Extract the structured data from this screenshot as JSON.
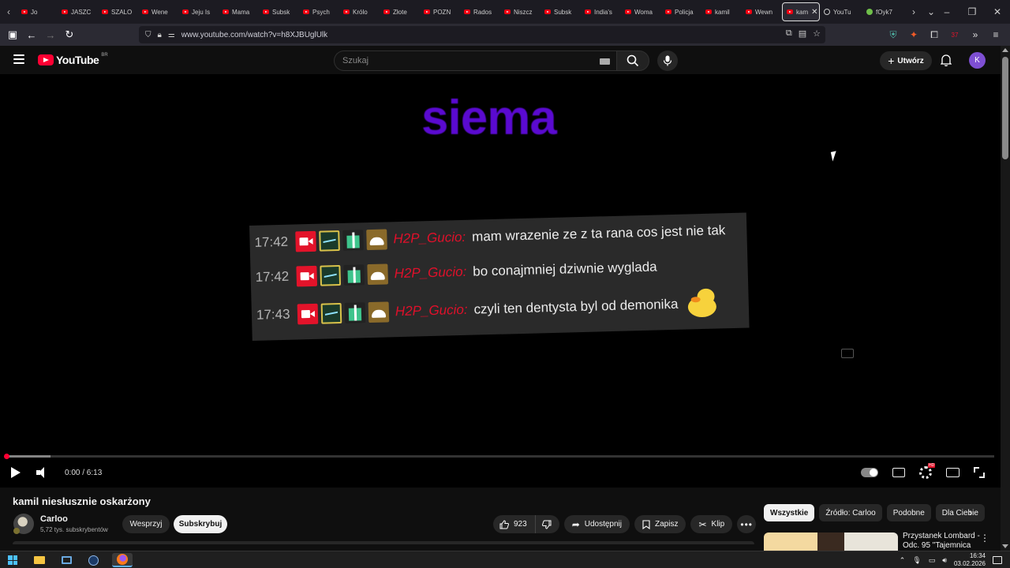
{
  "browser": {
    "tabs": [
      {
        "label": "Jo",
        "icon": "youtube-icon"
      },
      {
        "label": "JASZC",
        "icon": "youtube-icon"
      },
      {
        "label": "SZALO",
        "icon": "youtube-icon"
      },
      {
        "label": "Wene",
        "icon": "youtube-icon"
      },
      {
        "label": "Jeju Is",
        "icon": "youtube-icon"
      },
      {
        "label": "Mama",
        "icon": "youtube-icon"
      },
      {
        "label": "Subsk",
        "icon": "youtube-icon"
      },
      {
        "label": "Psych",
        "icon": "youtube-icon"
      },
      {
        "label": "Królo",
        "icon": "youtube-icon"
      },
      {
        "label": "Złote",
        "icon": "youtube-icon"
      },
      {
        "label": "POZN",
        "icon": "youtube-icon"
      },
      {
        "label": "Rados",
        "icon": "youtube-icon"
      },
      {
        "label": "Niszcz",
        "icon": "youtube-icon"
      },
      {
        "label": "Subsk",
        "icon": "youtube-icon"
      },
      {
        "label": "India's",
        "icon": "youtube-icon"
      },
      {
        "label": "Woma",
        "icon": "youtube-icon"
      },
      {
        "label": "Policja",
        "icon": "youtube-icon"
      },
      {
        "label": "kamil",
        "icon": "youtube-icon"
      },
      {
        "label": "Wewn",
        "icon": "youtube-icon"
      }
    ],
    "active_tab": {
      "label": "kam",
      "icon": "youtube-icon"
    },
    "after_tabs": [
      {
        "label": "YouTu"
      },
      {
        "label": "fOyk7"
      }
    ],
    "url": "www.youtube.com/watch?v=h8XJBUglUlk",
    "extension_badge": "37"
  },
  "youtube": {
    "logo_text": "YouTube",
    "region": "BR",
    "search_placeholder": "Szukaj",
    "create_label": "Utwórz",
    "avatar_letter": "K"
  },
  "video": {
    "overlay_text": "siema",
    "chat": [
      {
        "time": "17:42",
        "user": "H2P_Gucio:",
        "message": "mam wrazenie ze z ta rana cos jest nie tak"
      },
      {
        "time": "17:42",
        "user": "H2P_Gucio:",
        "message": "bo conajmniej dziwnie wyglada"
      },
      {
        "time": "17:43",
        "user": "H2P_Gucio:",
        "message": "czyli ten dentysta byl od demonika"
      }
    ],
    "time_display": "0:00 / 6:13",
    "progress_fraction": 0.0,
    "buffered_fraction": 0.045,
    "settings_badge": "HD"
  },
  "info": {
    "title": "kamil niesłusznie oskarżony",
    "channel_name": "Carloo",
    "subscribers": "5,72 tys. subskrybentów",
    "support_label": "Wesprzyj",
    "subscribe_label": "Subskrybuj",
    "likes": "923",
    "share_label": "Udostępnij",
    "save_label": "Zapisz",
    "clip_label": "Klip"
  },
  "sidebar": {
    "chips": [
      "Wszystkie",
      "Źródło: Carloo",
      "Podobne",
      "Dla Ciebie"
    ],
    "active_chip": "Wszystkie",
    "first_reco_title": "Przystanek Lombard - Odc. 95 \"Tajemnica"
  },
  "taskbar": {
    "time": "16:34",
    "date": "03.02.2026"
  }
}
